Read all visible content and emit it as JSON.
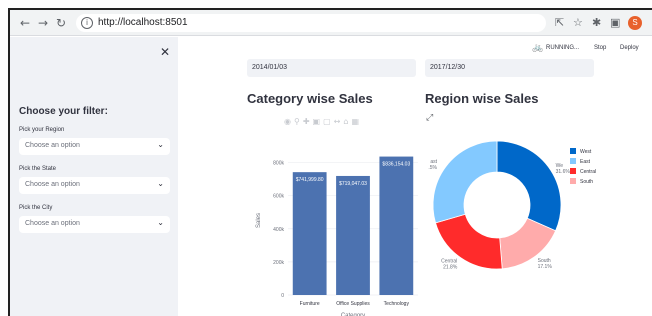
{
  "browser": {
    "url": "http://localhost:8501",
    "profile_initial": "S"
  },
  "app_header": {
    "status": "RUNNING...",
    "stop_label": "Stop",
    "deploy_label": "Deploy"
  },
  "sidebar": {
    "title": "Choose your filter:",
    "filters": [
      {
        "label": "Pick your Region",
        "placeholder": "Choose an option"
      },
      {
        "label": "Pick the State",
        "placeholder": "Choose an option"
      },
      {
        "label": "Pick the City",
        "placeholder": "Choose an option"
      }
    ]
  },
  "dates": {
    "start": "2014/01/03",
    "end": "2017/12/30"
  },
  "colors": {
    "bar": "#4c72b0",
    "west": "#0068c9",
    "east": "#83c9ff",
    "central": "#ff2b2b",
    "south": "#ffabab"
  },
  "chart_data": [
    {
      "type": "bar",
      "title": "Category wise Sales",
      "xlabel": "Category",
      "ylabel": "Sales",
      "categories": [
        "Furniture",
        "Office Supplies",
        "Technology"
      ],
      "values": [
        741999.8,
        719047.03,
        836154.03
      ],
      "data_labels": [
        "$741,999.80",
        "$719,047.03",
        "$836,154.03"
      ],
      "ylim": [
        0,
        900000
      ],
      "yticks": [
        0,
        200000,
        400000,
        600000,
        800000
      ],
      "ytick_labels": [
        "0",
        "200k",
        "400k",
        "600k",
        "800k"
      ],
      "grid": true
    },
    {
      "type": "pie",
      "title": "Region wise Sales",
      "hole": true,
      "labels": [
        "West",
        "East",
        "Central",
        "South"
      ],
      "values": [
        31.6,
        29.5,
        21.8,
        17.1
      ],
      "slice_labels": [
        "We\n31.6%",
        "ast\n.5%",
        "Central\n21.8%",
        "South\n17.1%"
      ],
      "legend": [
        "West",
        "East",
        "Central",
        "South"
      ],
      "legend_position": "top-right"
    }
  ]
}
